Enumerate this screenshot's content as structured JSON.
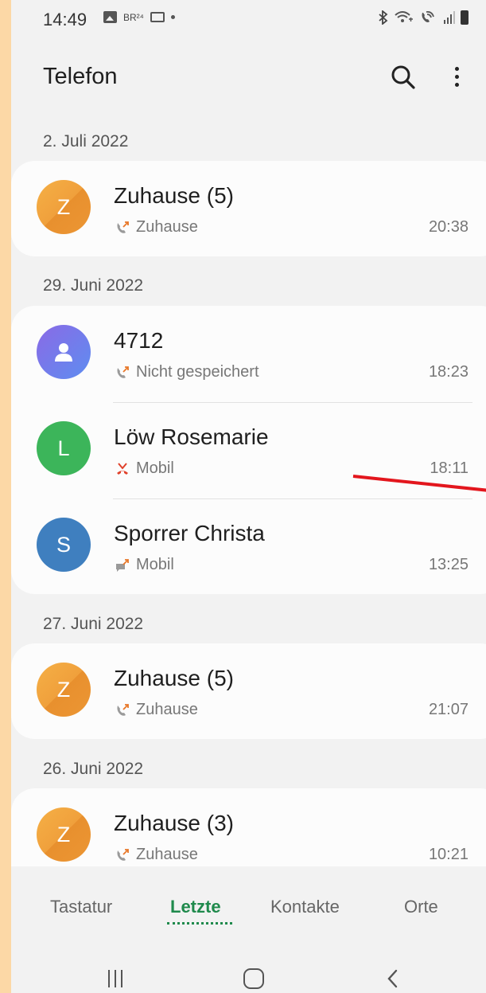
{
  "status_bar": {
    "time": "14:49",
    "br_label": "BR²⁴",
    "icons": [
      "gallery-icon",
      "br24-icon",
      "mail-icon",
      "dot-icon",
      "bluetooth-icon",
      "wifi-calling-icon",
      "volte-icon",
      "signal-icon",
      "battery-icon"
    ]
  },
  "header": {
    "title": "Telefon"
  },
  "sections": [
    {
      "date": "2. Juli 2022",
      "entries": [
        {
          "initial": "Z",
          "name": "Zuhause (5)",
          "label": "Zuhause",
          "time": "20:38",
          "call_type": "outgoing",
          "avatar_color": "#f0a03c"
        }
      ]
    },
    {
      "date": "29. Juni 2022",
      "entries": [
        {
          "initial": "",
          "name": "4712",
          "label": "Nicht gespeichert",
          "time": "18:23",
          "call_type": "outgoing",
          "avatar_color": "#7a78e8"
        },
        {
          "initial": "L",
          "name": "Löw Rosemarie",
          "label": "Mobil",
          "time": "18:11",
          "call_type": "missed",
          "avatar_color": "#3cb55a"
        },
        {
          "initial": "S",
          "name": "Sporrer Christa",
          "label": "Mobil",
          "time": "13:25",
          "call_type": "message",
          "avatar_color": "#3f7fbf"
        }
      ]
    },
    {
      "date": "27. Juni 2022",
      "entries": [
        {
          "initial": "Z",
          "name": "Zuhause (5)",
          "label": "Zuhause",
          "time": "21:07",
          "call_type": "outgoing",
          "avatar_color": "#f0a03c"
        }
      ]
    },
    {
      "date": "26. Juni 2022",
      "entries": [
        {
          "initial": "Z",
          "name": "Zuhause (3)",
          "label": "Zuhause",
          "time": "10:21",
          "call_type": "outgoing",
          "avatar_color": "#f0a03c"
        }
      ]
    }
  ],
  "bottom_tabs": [
    {
      "label": "Tastatur",
      "active": false
    },
    {
      "label": "Letzte",
      "active": true
    },
    {
      "label": "Kontakte",
      "active": false
    },
    {
      "label": "Orte",
      "active": false
    }
  ],
  "colors": {
    "accent": "#1f8a4c",
    "missed": "#e0402a",
    "annotation": "#e3161d",
    "frame": "#fcd8a6"
  }
}
